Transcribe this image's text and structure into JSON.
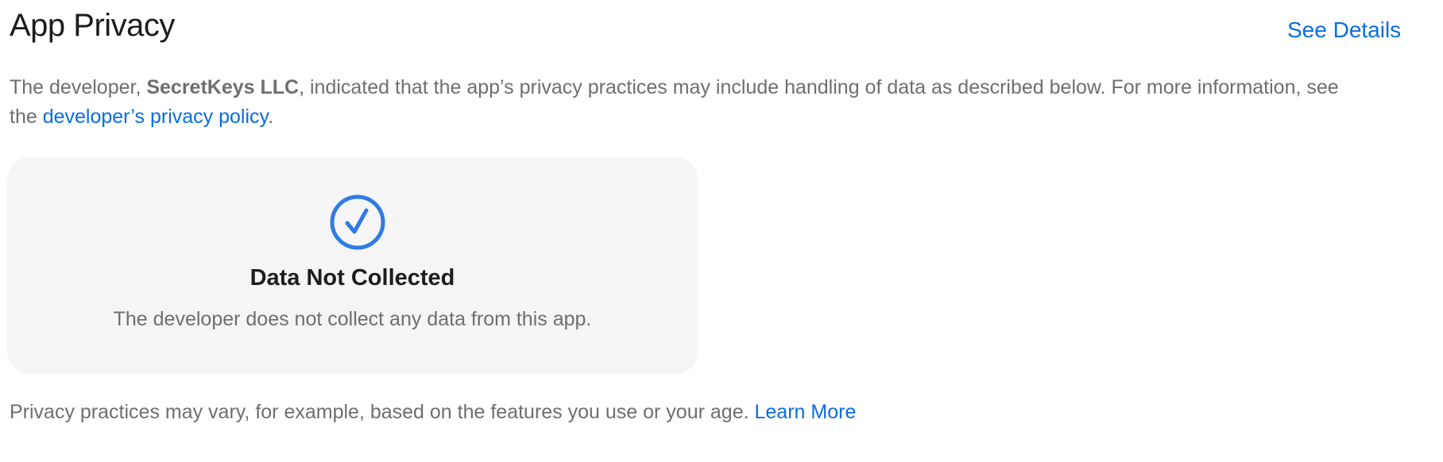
{
  "header": {
    "title": "App Privacy",
    "see_details": "See Details"
  },
  "description": {
    "prefix": "The developer, ",
    "developer_name": "SecretKeys LLC",
    "middle": ", indicated that the app’s privacy practices may include handling of data as described below. For more information, see the ",
    "policy_link": "developer’s privacy policy",
    "suffix": "."
  },
  "card": {
    "icon": "checkmark-circle-icon",
    "title": "Data Not Collected",
    "text": "The developer does not collect any data from this app."
  },
  "footer": {
    "text": "Privacy practices may vary, for example, based on the features you use or your age. ",
    "learn_more": "Learn More"
  },
  "colors": {
    "accent": "#0a6ddf",
    "icon": "#2f7be4",
    "card_background": "#f5f5f5",
    "secondary_text": "#6e6e73",
    "primary_text": "#1d1d1f"
  }
}
